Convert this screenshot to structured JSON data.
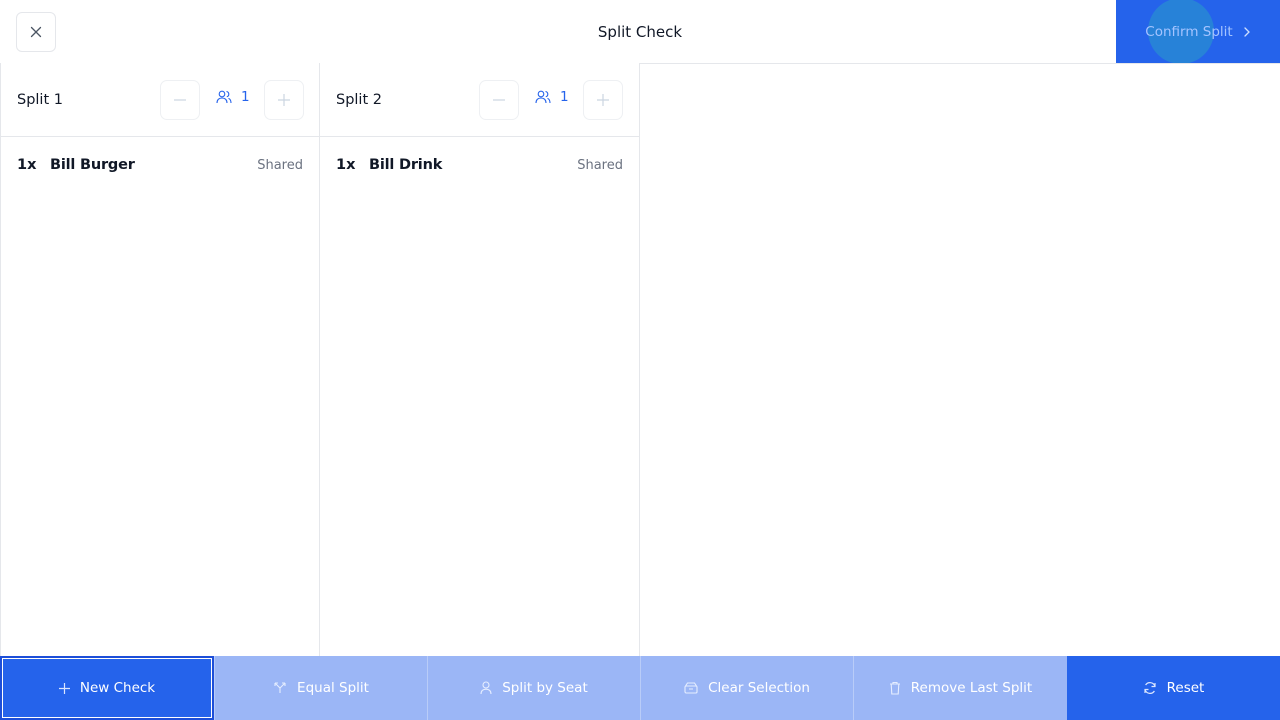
{
  "header": {
    "title": "Split Check",
    "close_icon": "close-icon",
    "confirm_label": "Confirm Split",
    "confirm_icon": "chevron-right-icon"
  },
  "splits": [
    {
      "name": "Split 1",
      "guest_count": "1",
      "items": [
        {
          "qty": "1x",
          "name": "Bill Burger",
          "tag": "Shared"
        }
      ]
    },
    {
      "name": "Split 2",
      "guest_count": "1",
      "items": [
        {
          "qty": "1x",
          "name": "Bill Drink",
          "tag": "Shared"
        }
      ]
    }
  ],
  "toolbar": {
    "new_check": "New Check",
    "equal_split": "Equal Split",
    "split_by_seat": "Split by Seat",
    "clear_selection": "Clear Selection",
    "remove_last_split": "Remove Last Split",
    "reset": "Reset"
  },
  "colors": {
    "primary": "#2563eb",
    "primary_disabled": "#9bb6f6",
    "border": "#e5e7eb",
    "muted_text": "#6b7280"
  }
}
